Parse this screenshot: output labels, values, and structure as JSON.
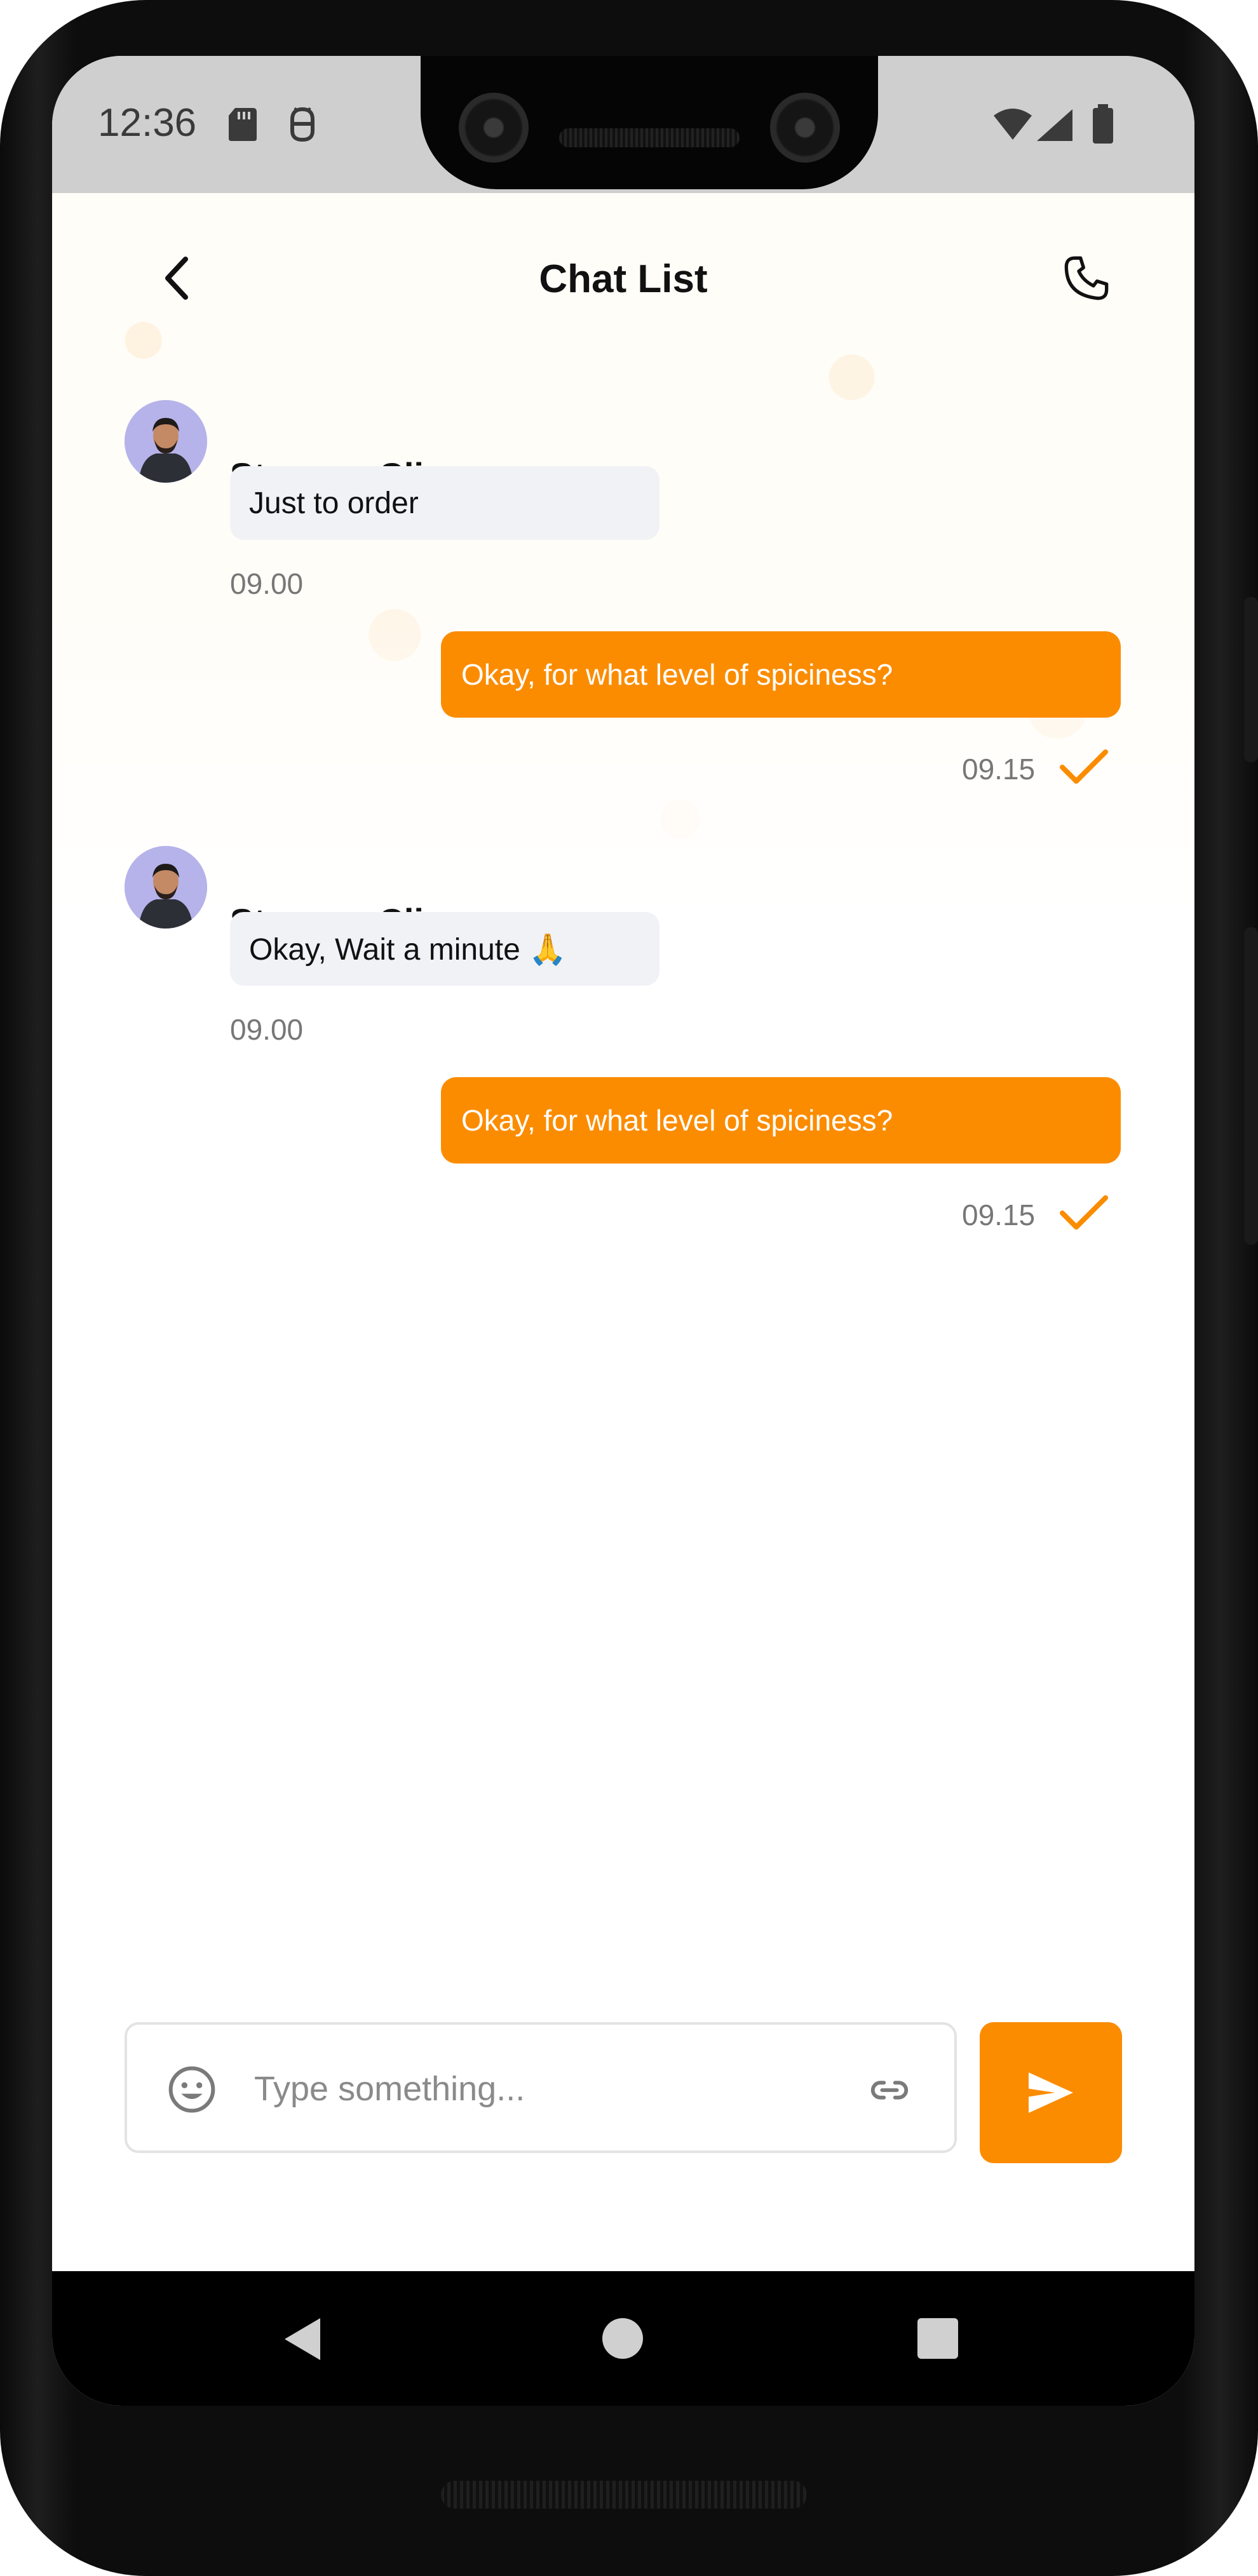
{
  "status_bar": {
    "time": "12:36"
  },
  "header": {
    "title": "Chat List",
    "back_icon": "chevron-left-icon",
    "call_icon": "phone-icon"
  },
  "messages": [
    {
      "direction": "incoming",
      "sender": "Stevano Clirover",
      "text": "Just to order",
      "time": "09.00"
    },
    {
      "direction": "outgoing",
      "text": "Okay, for what level of spiciness?",
      "time": "09.15",
      "status_icon": "check-icon"
    },
    {
      "direction": "incoming",
      "sender": "Stevano Clirover",
      "text": "Okay, Wait a minute 🙏",
      "time": "09.00"
    },
    {
      "direction": "outgoing",
      "text": "Okay, for what level of spiciness?",
      "time": "09.15",
      "status_icon": "check-icon"
    }
  ],
  "composer": {
    "placeholder": "Type something...",
    "emoji_icon": "emoji-icon",
    "attach_icon": "link-icon",
    "send_icon": "send-icon"
  },
  "colors": {
    "accent": "#FB8C00",
    "incoming_bubble": "#F1F2F6",
    "text": "#111111",
    "muted": "#777777"
  }
}
